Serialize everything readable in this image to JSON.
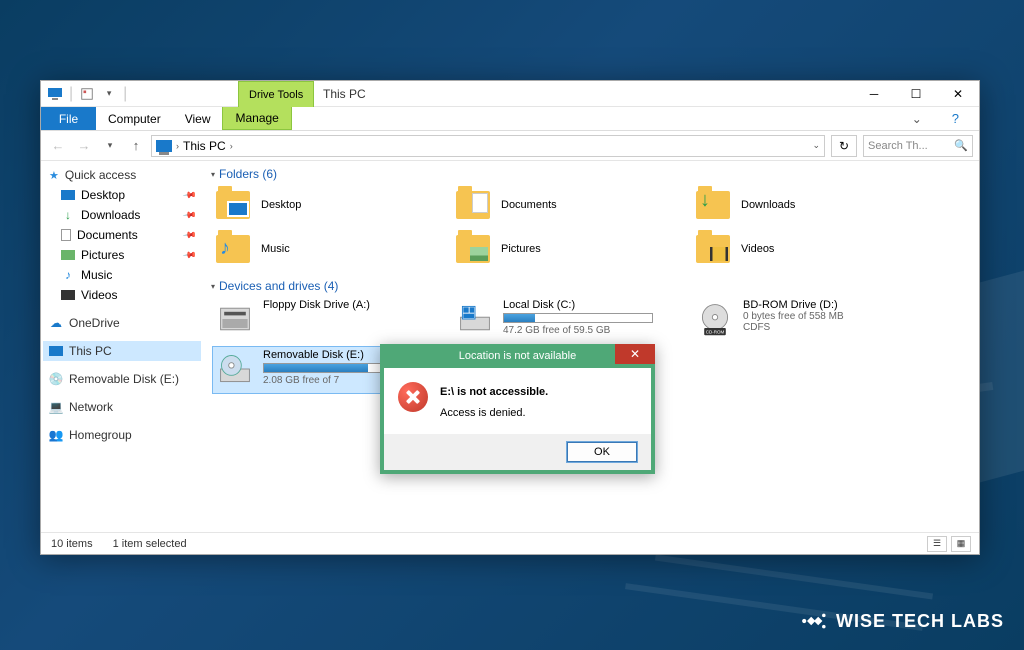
{
  "window": {
    "title": "This PC",
    "tools_tab": "Drive Tools",
    "tabs": {
      "file": "File",
      "computer": "Computer",
      "view": "View",
      "manage": "Manage"
    }
  },
  "nav": {
    "breadcrumb": "This PC",
    "search_placeholder": "Search Th..."
  },
  "sidebar": {
    "quick_access": "Quick access",
    "items": [
      {
        "label": "Desktop",
        "pinned": true
      },
      {
        "label": "Downloads",
        "pinned": true
      },
      {
        "label": "Documents",
        "pinned": true
      },
      {
        "label": "Pictures",
        "pinned": true
      },
      {
        "label": "Music",
        "pinned": false
      },
      {
        "label": "Videos",
        "pinned": false
      }
    ],
    "onedrive": "OneDrive",
    "this_pc": "This PC",
    "removable": "Removable Disk (E:)",
    "network": "Network",
    "homegroup": "Homegroup"
  },
  "sections": {
    "folders_hdr": "Folders (6)",
    "drives_hdr": "Devices and drives (4)"
  },
  "folders": [
    {
      "label": "Desktop"
    },
    {
      "label": "Documents"
    },
    {
      "label": "Downloads"
    },
    {
      "label": "Music"
    },
    {
      "label": "Pictures"
    },
    {
      "label": "Videos"
    }
  ],
  "drives": [
    {
      "name": "Floppy Disk Drive (A:)",
      "sub": "",
      "bar": false
    },
    {
      "name": "Local Disk (C:)",
      "sub": "47.2 GB free of 59.5 GB",
      "bar": true,
      "fill_pct": 21
    },
    {
      "name": "BD-ROM Drive (D:)",
      "sub": "0 bytes free of 558 MB",
      "sub2": "CDFS",
      "bar": false
    },
    {
      "name": "Removable Disk (E:)",
      "sub": "2.08 GB free of 7",
      "bar": true,
      "fill_pct": 70,
      "selected": true
    }
  ],
  "status": {
    "items": "10 items",
    "selected": "1 item selected"
  },
  "dialog": {
    "title": "Location is not available",
    "line1": "E:\\ is not accessible.",
    "line2": "Access is denied.",
    "ok": "OK"
  },
  "brand": "WISE TECH LABS"
}
